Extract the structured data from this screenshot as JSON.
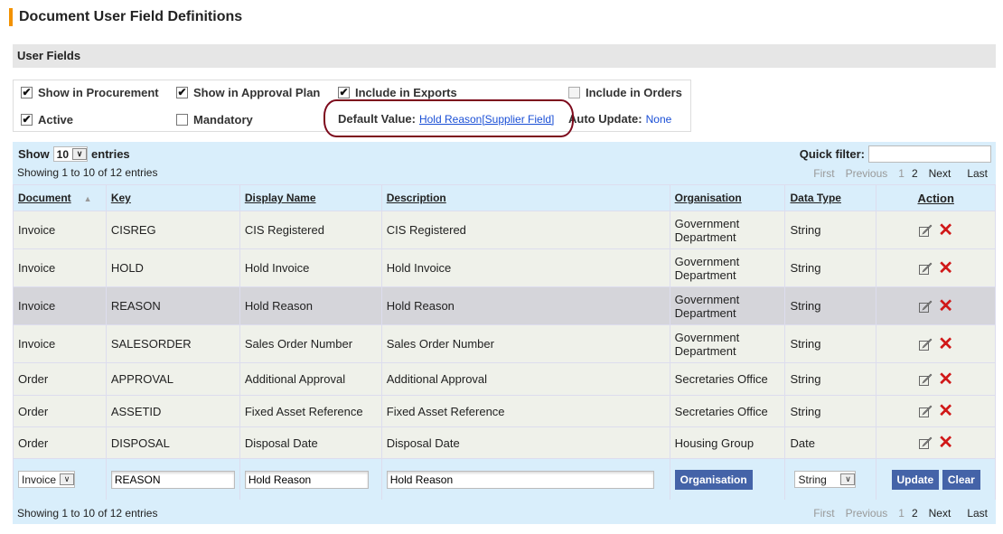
{
  "title": "Document User Field Definitions",
  "section": "User Fields",
  "options": {
    "show_in_procurement": {
      "label": "Show in Procurement",
      "checked": true
    },
    "show_in_approval_plan": {
      "label": "Show in Approval Plan",
      "checked": true
    },
    "include_in_exports": {
      "label": "Include in Exports",
      "checked": true
    },
    "include_in_orders": {
      "label": "Include in Orders",
      "checked": false
    },
    "active": {
      "label": "Active",
      "checked": true
    },
    "mandatory": {
      "label": "Mandatory",
      "checked": false
    },
    "default_value_label": "Default Value:",
    "default_value": "Hold Reason[Supplier Field]",
    "auto_update_label": "Auto Update:",
    "auto_update": "None"
  },
  "table_controls": {
    "show": "Show",
    "page_size": "10",
    "entries": "entries",
    "info": "Showing 1 to 10 of 12 entries",
    "quick_filter": "Quick filter:",
    "quick_filter_value": ""
  },
  "pager": {
    "first": "First",
    "previous": "Previous",
    "p1": "1",
    "p2": "2",
    "next": "Next",
    "last": "Last"
  },
  "columns": [
    "Document",
    "Key",
    "Display Name",
    "Description",
    "Organisation",
    "Data Type",
    "Action"
  ],
  "rows": [
    [
      "Invoice",
      "CISREG",
      "CIS Registered",
      "CIS Registered",
      "Government Department",
      "String"
    ],
    [
      "Invoice",
      "HOLD",
      "Hold Invoice",
      "Hold Invoice",
      "Government Department",
      "String"
    ],
    [
      "Invoice",
      "REASON",
      "Hold Reason",
      "Hold Reason",
      "Government Department",
      "String"
    ],
    [
      "Invoice",
      "SALESORDER",
      "Sales Order Number",
      "Sales Order Number",
      "Government Department",
      "String"
    ],
    [
      "Order",
      "APPROVAL",
      "Additional Approval",
      "Additional Approval",
      "Secretaries Office",
      "String"
    ],
    [
      "Order",
      "ASSETID",
      "Fixed Asset Reference",
      "Fixed Asset Reference",
      "Secretaries Office",
      "String"
    ],
    [
      "Order",
      "DISPOSAL",
      "Disposal Date",
      "Disposal Date",
      "Housing Group",
      "Date"
    ]
  ],
  "edit_row": {
    "document": "Invoice",
    "key": "REASON",
    "display_name": "Hold Reason",
    "description": "Hold Reason",
    "organisation_button": "Organisation",
    "data_type": "String",
    "update": "Update",
    "clear": "Clear"
  },
  "colors": {
    "accent": "#f39200",
    "highlight_oval": "#7d0a1c",
    "button": "#4463a8",
    "delete": "#d01818"
  }
}
